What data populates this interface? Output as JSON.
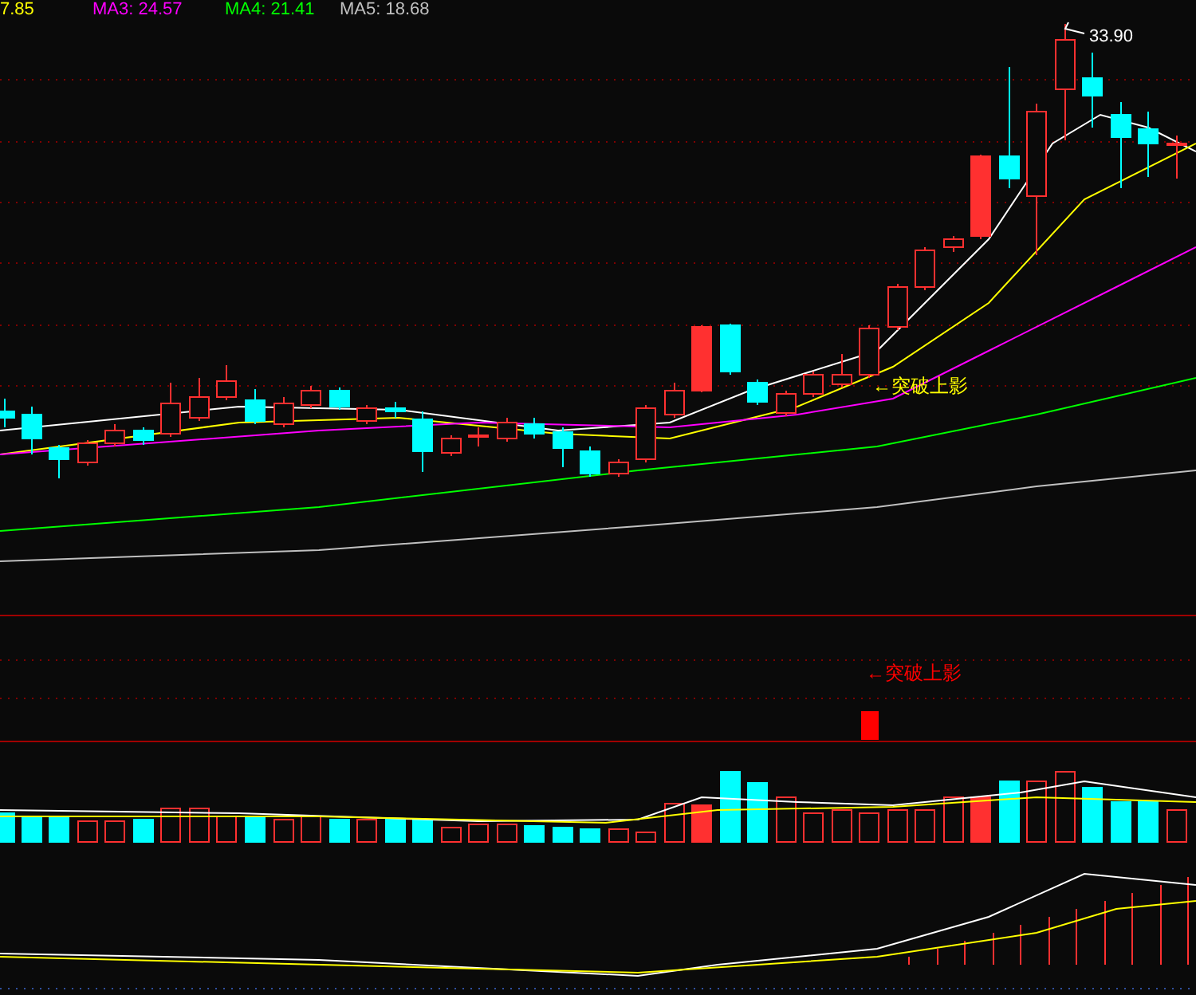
{
  "main_panel": {
    "legend": [
      {
        "text": "7.85",
        "color": "#ffff00"
      },
      {
        "text": "MA3: 24.57",
        "color": "#ff00ff"
      },
      {
        "text": "MA4: 21.41",
        "color": "#00ff00"
      },
      {
        "text": "MA5: 18.68",
        "color": "#c0c0c0"
      }
    ],
    "high_label": "33.90",
    "signal_label": {
      "text": "←突破上影",
      "color": "#ffff00"
    }
  },
  "signal_panel": {
    "signal_label": {
      "text": "←突破上影",
      "color": "#ff0000"
    }
  }
}
